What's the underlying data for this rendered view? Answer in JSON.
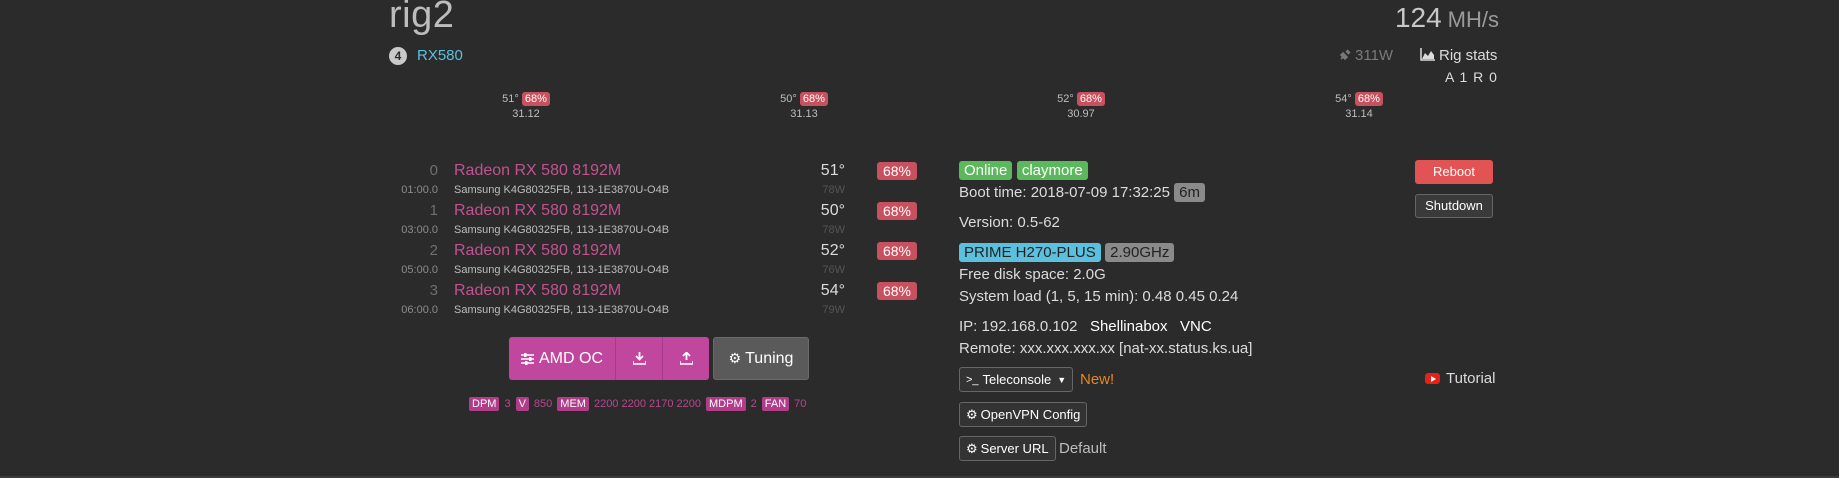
{
  "header": {
    "rig_name": "rig2",
    "hashrate_value": "124",
    "hashrate_unit": "MH/s",
    "gpu_count": "4",
    "gpu_model": "RX580",
    "power": "311W",
    "rig_stats_label": "Rig stats",
    "accepted_rejected": "A 1  R 0"
  },
  "summary": [
    {
      "temp": "51°",
      "fan": "68%",
      "hash": "31.12"
    },
    {
      "temp": "50°",
      "fan": "68%",
      "hash": "31.13"
    },
    {
      "temp": "52°",
      "fan": "68%",
      "hash": "30.97"
    },
    {
      "temp": "54°",
      "fan": "68%",
      "hash": "31.14"
    }
  ],
  "gpus": [
    {
      "idx": "0",
      "name": "Radeon RX 580 8192M",
      "bus": "01:00.0",
      "mem": "Samsung K4G80325FB, 113-1E3870U-O4B",
      "temp": "51°",
      "watt": "78W",
      "fan": "68%"
    },
    {
      "idx": "1",
      "name": "Radeon RX 580 8192M",
      "bus": "03:00.0",
      "mem": "Samsung K4G80325FB, 113-1E3870U-O4B",
      "temp": "50°",
      "watt": "78W",
      "fan": "68%"
    },
    {
      "idx": "2",
      "name": "Radeon RX 580 8192M",
      "bus": "05:00.0",
      "mem": "Samsung K4G80325FB, 113-1E3870U-O4B",
      "temp": "52°",
      "watt": "76W",
      "fan": "68%"
    },
    {
      "idx": "3",
      "name": "Radeon RX 580 8192M",
      "bus": "06:00.0",
      "mem": "Samsung K4G80325FB, 113-1E3870U-O4B",
      "temp": "54°",
      "watt": "79W",
      "fan": "68%"
    }
  ],
  "oc": {
    "amd_oc_label": "AMD OC",
    "tuning_label": "Tuning",
    "dpm_tag": "DPM",
    "dpm_val": "3",
    "v_tag": "V",
    "v_val": "850",
    "mem_tag": "MEM",
    "mem_val": "2200 2200 2170 2200",
    "mdpm_tag": "MDPM",
    "mdpm_val": "2",
    "fan_tag": "FAN",
    "fan_val": "70"
  },
  "status": {
    "online": "Online",
    "miner": "claymore",
    "boot_label": "Boot time:",
    "boot_time": "2018-07-09 17:32:25",
    "uptime": "6m",
    "version": "Version: 0.5-62",
    "motherboard": "PRIME H270-PLUS",
    "cpu_freq": "2.90GHz",
    "disk": "Free disk space: 2.0G",
    "load": "System load (1, 5, 15 min): 0.48 0.45 0.24",
    "ip": "IP: 192.168.0.102",
    "shellinabox": "Shellinabox",
    "vnc": "VNC",
    "remote": "Remote: xxx.xxx.xxx.xx [nat-xx.status.ks.ua]",
    "teleconsole": "Teleconsole",
    "new_label": "New!",
    "openvpn": "OpenVPN Config",
    "server_url": "Server URL",
    "server_default": "Default",
    "tutorial": "Tutorial"
  },
  "actions": {
    "reboot": "Reboot",
    "shutdown": "Shutdown"
  }
}
